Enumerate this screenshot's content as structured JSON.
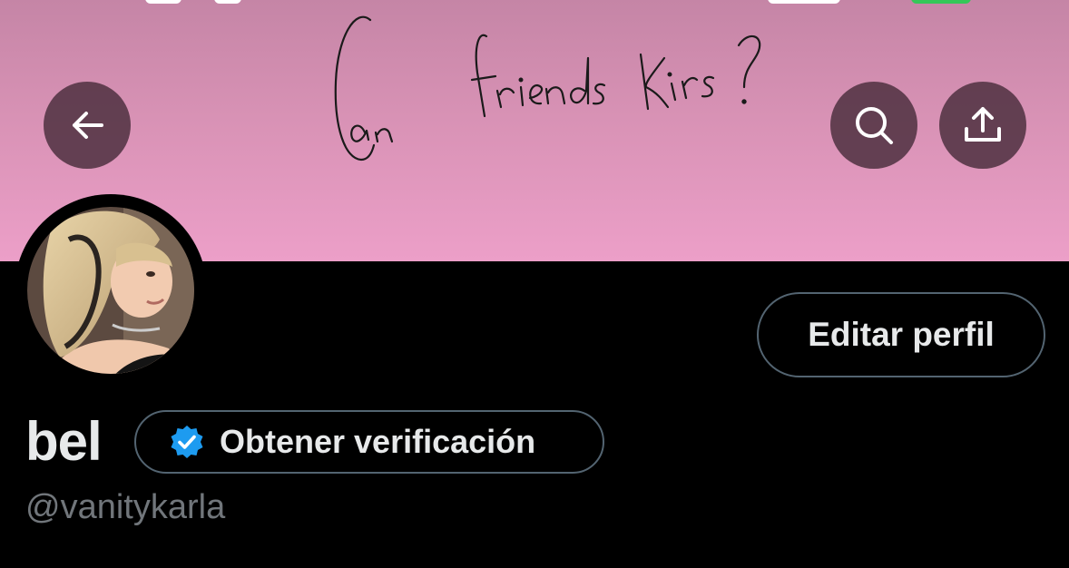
{
  "header": {
    "banner_text": "Can friends Kiss?",
    "back_icon": "arrow-left-icon",
    "search_icon": "search-icon",
    "share_icon": "share-upload-icon"
  },
  "profile": {
    "display_name": "bel",
    "handle": "@vanitykarla",
    "edit_button_label": "Editar perfil",
    "verification_label": "Obtener verificación",
    "verification_icon": "verified-badge-icon"
  },
  "colors": {
    "background": "#000000",
    "banner_top": "#c585a6",
    "banner_bottom": "#ec9fc8",
    "button_overlay": "#4e3040",
    "verified_blue": "#1d9bf0",
    "text_primary": "#e7e9ea",
    "text_secondary": "#71767b",
    "border": "#536471"
  }
}
